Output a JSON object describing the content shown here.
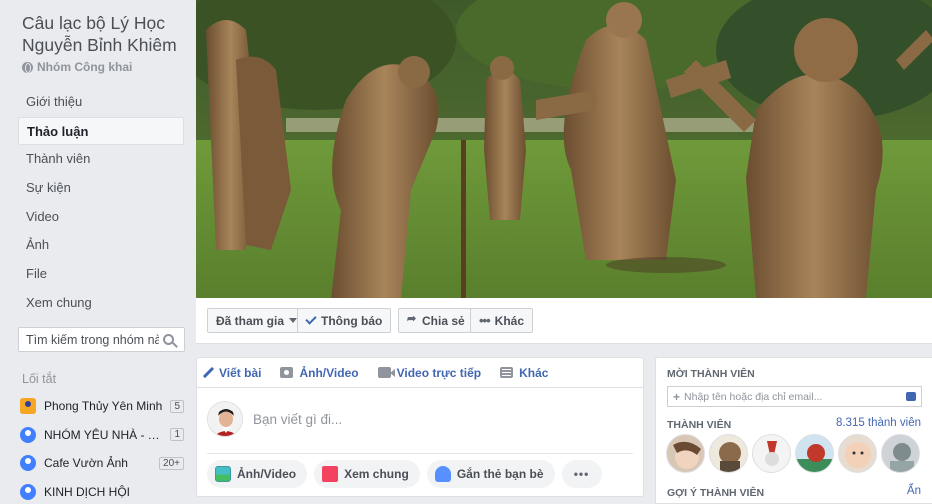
{
  "group": {
    "name": "Câu lạc bộ Lý Học Nguyễn Bỉnh Khiêm",
    "privacy": "Nhóm Công khai"
  },
  "nav": {
    "items": [
      {
        "label": "Giới thiệu",
        "active": false
      },
      {
        "label": "Thảo luận",
        "active": true
      },
      {
        "label": "Thành viên",
        "active": false
      },
      {
        "label": "Sự kiện",
        "active": false
      },
      {
        "label": "Video",
        "active": false
      },
      {
        "label": "Ảnh",
        "active": false
      },
      {
        "label": "File",
        "active": false
      },
      {
        "label": "Xem chung",
        "active": false
      }
    ]
  },
  "group_search": {
    "placeholder": "Tìm kiếm trong nhóm này"
  },
  "shortcuts": {
    "title": "Lối tắt",
    "items": [
      {
        "label": "Phong Thủy Yên Minh",
        "badge": "5",
        "icon": "brand-logo-icon"
      },
      {
        "label": "NHÓM YÊU NHÀ - T…",
        "badge": "1",
        "icon": "group-icon"
      },
      {
        "label": "Cafe Vườn Ảnh",
        "badge": "20+",
        "icon": "group-icon"
      },
      {
        "label": "KINH DỊCH HỘI",
        "badge": "",
        "icon": "group-icon"
      }
    ]
  },
  "actions": {
    "joined": "Đã tham gia",
    "notifications": "Thông báo",
    "share": "Chia sẻ",
    "more": "Khác"
  },
  "composer": {
    "tabs": {
      "write": "Viết bài",
      "photo_video": "Ảnh/Video",
      "live_video": "Video trực tiếp",
      "more": "Khác"
    },
    "placeholder": "Bạn viết gì đi...",
    "buttons": {
      "photo_video": "Ảnh/Video",
      "watch_party": "Xem chung",
      "tag_friends": "Gắn thẻ bạn bè",
      "more": "•••"
    }
  },
  "right_panel": {
    "invite_title": "MỜI THÀNH VIÊN",
    "invite_placeholder": "Nhập tên hoặc địa chỉ email...",
    "plus": "+",
    "members_title": "THÀNH VIÊN",
    "members_count": "8.315 thành viên",
    "suggest_title": "GỢI Ý THÀNH VIÊN",
    "hide": "Ẩn"
  },
  "colors": {
    "fb_blue": "#4267b2",
    "background": "#e9ebee",
    "cover_grass": "#6f8f3e",
    "statue_bronze": "#8a6a44"
  }
}
